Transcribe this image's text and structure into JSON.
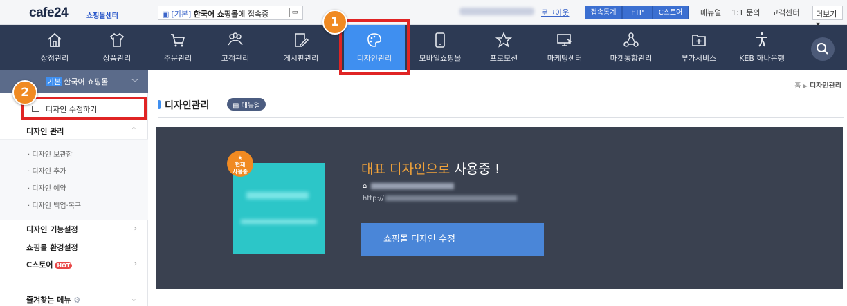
{
  "topbar": {
    "logo": "cafe24",
    "logo_sub": "쇼핑몰센터",
    "shop_tag": "[기본]",
    "shop_name": "한국어 쇼핑몰",
    "shop_suffix": "에 접속중",
    "logout": "로그아웃",
    "buttons": [
      "접속통계",
      "FTP",
      "C스토어"
    ],
    "links": [
      "매뉴얼",
      "1:1 문의",
      "고객센터"
    ],
    "more": "더보기"
  },
  "nav": {
    "items": [
      {
        "label": "상점관리",
        "icon": "home-icon"
      },
      {
        "label": "상품관리",
        "icon": "shirt-icon"
      },
      {
        "label": "주문관리",
        "icon": "cart-icon"
      },
      {
        "label": "고객관리",
        "icon": "people-icon"
      },
      {
        "label": "게시판관리",
        "icon": "edit-icon"
      },
      {
        "label": "디자인관리",
        "icon": "palette-icon"
      },
      {
        "label": "모바일쇼핑몰",
        "icon": "mobile-icon"
      },
      {
        "label": "프로모션",
        "icon": "star-icon"
      },
      {
        "label": "마케팅센터",
        "icon": "monitor-icon"
      },
      {
        "label": "마켓통합관리",
        "icon": "network-icon"
      },
      {
        "label": "부가서비스",
        "icon": "plus-box-icon"
      },
      {
        "label": "KEB 하나은행",
        "icon": "bank-icon"
      }
    ],
    "active": "디자인관리",
    "accent": "#3f8ff0"
  },
  "annotations": {
    "step1": "1",
    "step2": "2"
  },
  "sidebar": {
    "shop_tag": "기본",
    "shop_name": "한국어 쇼핑몰",
    "edit_button": "디자인 수정하기",
    "section_design": "디자인 관리",
    "sub_items": [
      "· 디자인 보관함",
      "· 디자인 추가",
      "· 디자인 예약",
      "· 디자인 백업·복구"
    ],
    "section_func": "디자인 기능설정",
    "section_env": "쇼핑몰 환경설정",
    "section_cstore": "C스토어",
    "hot": "HOT",
    "favorites": "즐겨찾는 메뉴"
  },
  "main": {
    "breadcrumb_home": "홈",
    "breadcrumb_current": "디자인관리",
    "title": "디자인관리",
    "manual_badge": "매뉴얼",
    "current_badge_line1": "현재",
    "current_badge_line2": "사용중",
    "rep_highlight": "대표 디자인으로",
    "rep_rest": " 사용중 !",
    "url_prefix": "http://",
    "edit_button": "쇼핑몰 디자인 수정"
  }
}
